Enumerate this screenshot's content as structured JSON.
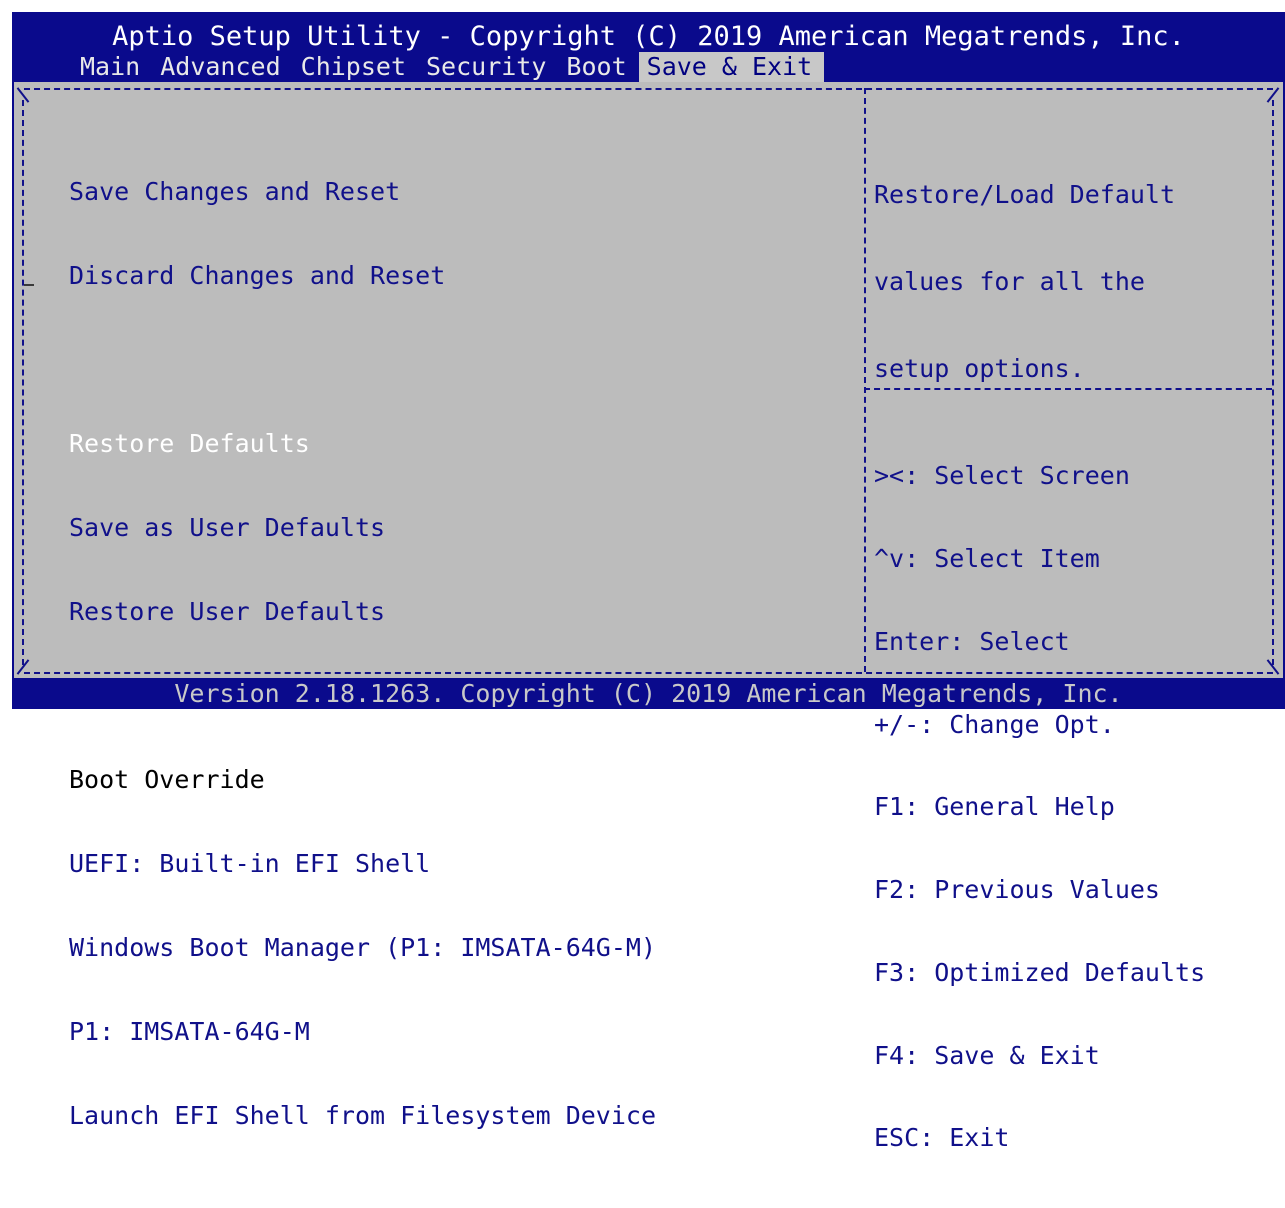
{
  "title": "Aptio Setup Utility - Copyright (C) 2019 American Megatrends, Inc.",
  "tabs": [
    {
      "label": "Main",
      "active": false
    },
    {
      "label": "Advanced",
      "active": false
    },
    {
      "label": "Chipset",
      "active": false
    },
    {
      "label": "Security",
      "active": false
    },
    {
      "label": "Boot",
      "active": false
    },
    {
      "label": "Save & Exit",
      "active": true
    }
  ],
  "menu": {
    "save_reset": "Save Changes and Reset",
    "discard_reset": "Discard Changes and Reset",
    "restore_defaults": "Restore Defaults",
    "save_user_defaults": "Save as User Defaults",
    "restore_user_defaults": "Restore User Defaults",
    "boot_override_header": "Boot Override",
    "boot_options": [
      "UEFI: Built-in EFI Shell",
      "Windows Boot Manager (P1: IMSATA-64G-M)",
      "P1: IMSATA-64G-M",
      "Launch EFI Shell from Filesystem Device"
    ]
  },
  "help_text": [
    "Restore/Load Default",
    "values for all the",
    "setup options."
  ],
  "key_help": [
    "><: Select Screen",
    "^v: Select Item",
    "Enter: Select",
    "+/-: Change Opt.",
    "F1: General Help",
    "F2: Previous Values",
    "F3: Optimized Defaults",
    "F4: Save & Exit",
    "ESC: Exit"
  ],
  "footer": "Version 2.18.1263. Copyright (C) 2019 American Megatrends, Inc.",
  "colors": {
    "background_blue": "#0a0a8c",
    "panel_gray": "#bcbcbc",
    "text_blue": "#10108a",
    "highlight_white": "#ffffff"
  }
}
